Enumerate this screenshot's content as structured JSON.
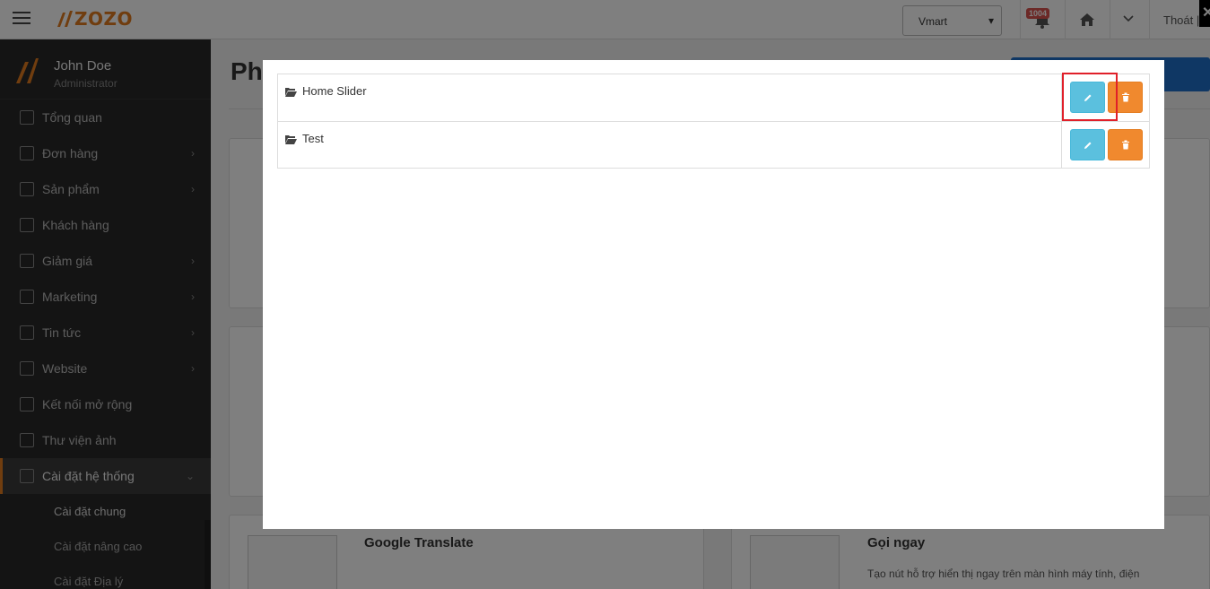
{
  "header": {
    "logo_text": "ZOZO",
    "store_select": "Vmart",
    "notification_count": "1004",
    "logout_label": "Thoát |"
  },
  "sidebar": {
    "user_name": "John Doe",
    "user_role": "Administrator",
    "items": [
      {
        "label": "Tổng quan",
        "arrow": false
      },
      {
        "label": "Đơn hàng",
        "arrow": true
      },
      {
        "label": "Sản phẩm",
        "arrow": true
      },
      {
        "label": "Khách hàng",
        "arrow": false
      },
      {
        "label": "Giảm giá",
        "arrow": true
      },
      {
        "label": "Marketing",
        "arrow": true
      },
      {
        "label": "Tin tức",
        "arrow": true
      },
      {
        "label": "Website",
        "arrow": true
      },
      {
        "label": "Kết nối mở rộng",
        "arrow": false
      },
      {
        "label": "Thư viện ảnh",
        "arrow": false
      },
      {
        "label": "Cài đặt hệ thống",
        "arrow": true,
        "active": true
      }
    ],
    "sub_items": [
      "Cài đặt chung",
      "Cài đặt nâng cao",
      "Cài đặt Địa lý"
    ]
  },
  "content": {
    "page_title": "Ph",
    "card_google_title": "Google Translate",
    "card_call_title": "Gọi ngay",
    "card_call_desc": "Tạo nút hỗ trợ hiển thị ngay trên màn hình máy tính, điện"
  },
  "modal": {
    "rows": [
      {
        "name": "Home Slider"
      },
      {
        "name": "Test"
      }
    ]
  },
  "colors": {
    "accent": "#e07a1f",
    "edit_button": "#5bc0de",
    "delete_button": "#f0892e",
    "highlight": "#e0202a"
  }
}
